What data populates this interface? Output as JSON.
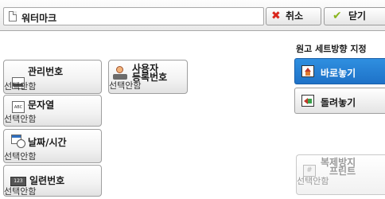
{
  "header": {
    "title": "워터마크",
    "cancel_label": "취소",
    "close_label": "닫기"
  },
  "items": {
    "control_number": {
      "label": "관리번호",
      "status": "선택안함"
    },
    "user_id": {
      "label_line1": "사용자",
      "label_line2": "등록번호",
      "status": "선택안함"
    },
    "string": {
      "label": "문자열",
      "status": "선택안함"
    },
    "date_time": {
      "label": "날짜/시간",
      "status": "선택안함"
    },
    "serial_number": {
      "label": "일련번호",
      "status": "선택안함"
    },
    "copy_protect": {
      "label_line1": "복제방지",
      "label_line2": "프린트",
      "status": "선택안함"
    }
  },
  "orientation": {
    "title": "원고 세트방향 지정",
    "options": [
      {
        "label": "바로놓기",
        "selected": true
      },
      {
        "label": "돌려놓기",
        "selected": false
      }
    ]
  },
  "colors": {
    "selected": "#1e72c8",
    "cancel_icon": "#d9261c",
    "close_icon": "#8ab51f"
  }
}
